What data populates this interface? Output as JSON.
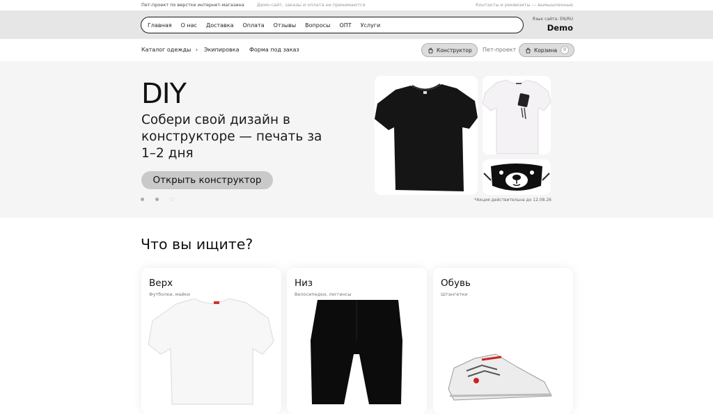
{
  "topstrip": {
    "left": "Пет-проект по верстке интернет-магазина",
    "center": "Демо-сайт, заказы и оплата не принимаются",
    "right": "Контакты и реквизиты — вымышленные"
  },
  "nav": {
    "items": [
      "Главная",
      "О нас",
      "Доставка",
      "Оплата",
      "Отзывы",
      "Вопросы",
      "ОПТ",
      "Услуги"
    ],
    "lang_label": "Язык сайта: EN/RU",
    "brand": "Demo"
  },
  "subnav": {
    "catalog": "Каталог одежды",
    "equipment": "Экипировка",
    "uniform": "Форма под заказ",
    "constructor_btn": "Конструктор",
    "pet_project": "Пет-проект",
    "cart_btn": "Корзина",
    "cart_count": "0"
  },
  "hero": {
    "title": "DIY",
    "subtitle": "Собери свой дизайн в конструкторе — печать за 1–2 дня",
    "cta": "Открыть конструктор",
    "promo": "*Акция действительна до 12.08.26",
    "slides_total": 3,
    "slide_active": 1
  },
  "categories_section": {
    "title": "Что вы ищите?",
    "items": [
      {
        "title": "Верх",
        "subtitle": "Футболки, майки"
      },
      {
        "title": "Низ",
        "subtitle": "Велосипедки, леггинсы"
      },
      {
        "title": "Обувь",
        "subtitle": "Штангетки"
      }
    ]
  },
  "colors": {
    "nav_band": "#e6e6e6",
    "hero_bg": "#f5f5f5",
    "cta_bg": "#c9c9c9",
    "text": "#1a1a1a"
  }
}
